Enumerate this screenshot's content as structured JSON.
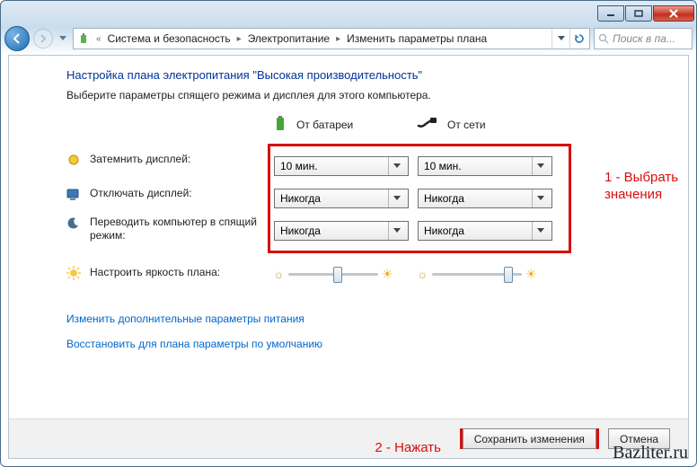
{
  "window": {
    "breadcrumbs": [
      "Система и безопасность",
      "Электропитание",
      "Изменить параметры плана"
    ],
    "search_placeholder": "Поиск в па..."
  },
  "page": {
    "title": "Настройка плана электропитания \"Высокая производительность\"",
    "subtitle": "Выберите параметры спящего режима и дисплея для этого компьютера."
  },
  "columns": {
    "battery": "От батареи",
    "plugged": "От сети"
  },
  "rows": {
    "dim": {
      "label": "Затемнить дисплей:",
      "battery": "10 мин.",
      "plugged": "10 мин."
    },
    "off": {
      "label": "Отключать дисплей:",
      "battery": "Никогда",
      "plugged": "Никогда"
    },
    "sleep": {
      "label": "Переводить компьютер в спящий режим:",
      "battery": "Никогда",
      "plugged": "Никогда"
    },
    "bright": {
      "label": "Настроить яркость плана:"
    }
  },
  "brightness": {
    "battery_pct": 55,
    "plugged_pct": 85
  },
  "links": {
    "advanced": "Изменить дополнительные параметры питания",
    "restore": "Восстановить для плана параметры по умолчанию"
  },
  "footer": {
    "save": "Сохранить изменения",
    "cancel": "Отмена"
  },
  "annotations": {
    "step1": "1 - Выбрать значения",
    "step2": "2 - Нажать"
  },
  "watermark": "Bazliter.ru"
}
